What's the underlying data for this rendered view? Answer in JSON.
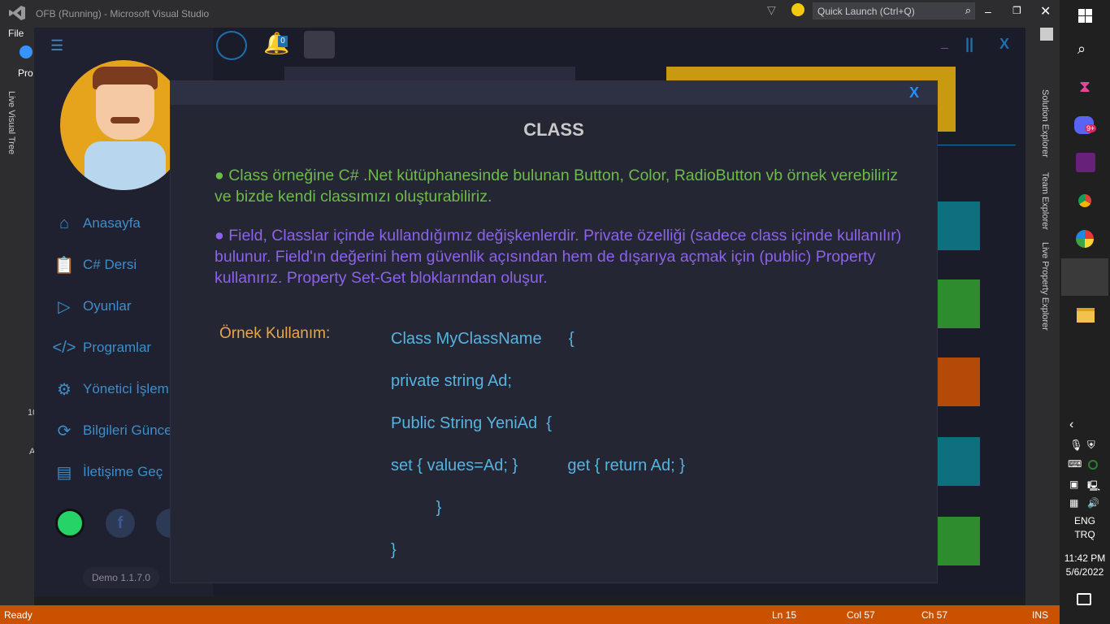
{
  "vs": {
    "title": "OFB (Running) - Microsoft Visual Studio",
    "quick_launch_placeholder": "Quick Launch (Ctrl+Q)",
    "menu_file": "File",
    "left_tab_pro": "Pro",
    "live_visual_tree": "Live Visual Tree",
    "right_tabs": [
      "Solution Explorer",
      "Team Explorer",
      "Live Property Explorer"
    ],
    "status": {
      "ready": "Ready",
      "ln": "Ln 15",
      "col": "Col 57",
      "ch": "Ch 57",
      "ins": "INS"
    },
    "left_number": "10",
    "left_letter_a": "A"
  },
  "taskbar": {
    "lang": "ENG",
    "layout": "TRQ",
    "time": "11:42 PM",
    "date": "5/6/2022",
    "discord_badge": "9+"
  },
  "app": {
    "notification_count": "0",
    "window_controls": {
      "minimize": "_",
      "pause": "||",
      "close": "X"
    },
    "nav": [
      {
        "label": "Anasayfa",
        "icon": "home-icon"
      },
      {
        "label": "C# Dersi",
        "icon": "clipboard-icon"
      },
      {
        "label": "Oyunlar",
        "icon": "play-icon"
      },
      {
        "label": "Programlar",
        "icon": "code-icon"
      },
      {
        "label": "Yönetici İşlem",
        "icon": "gears-icon"
      },
      {
        "label": "Bilgileri Günce",
        "icon": "refresh-check-icon"
      },
      {
        "label": "İletişime Geç",
        "icon": "contact-book-icon"
      }
    ],
    "version": "Demo 1.1.7.0",
    "social": [
      "whatsapp-icon",
      "facebook-icon",
      "web-icon"
    ],
    "colors": {
      "tile_teal": "#0e6f7f",
      "tile_green": "#2e8b2e",
      "tile_orange": "#b34a08",
      "banner_gold": "#c89a0f"
    }
  },
  "modal": {
    "close": "X",
    "title": "CLASS",
    "para1": "● Class örneğine C# .Net kütüphanesinde bulunan Button, Color, RadioButton vb örnek verebiliriz ve bizde kendi classımızı oluşturabiliriz.",
    "para2": "● Field, Classlar içinde kullandığımız değişkenlerdir. Private özelliği (sadece class içinde kullanılır) bulunur. Field'ın değerini hem güvenlik açısından hem de dışarıya açmak için (public) Property kullanırız. Property Set-Get bloklarından oluşur.",
    "example_label": "Örnek Kullanım:",
    "code": [
      "Class MyClassName      {",
      "private string Ad;",
      "Public String YeniAd  {",
      "set { values=Ad; }           get { return Ad; }",
      "          }",
      "}"
    ]
  }
}
